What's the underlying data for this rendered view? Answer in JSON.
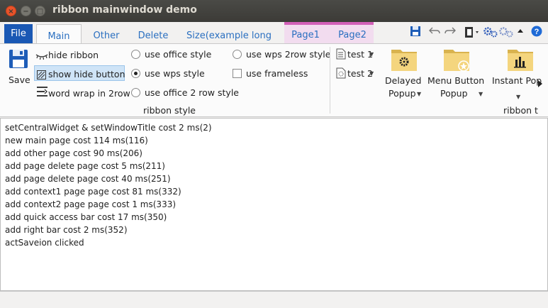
{
  "window": {
    "title": "ribbon mainwindow demo"
  },
  "titlebar": {
    "close_glyph": "×",
    "min_glyph": "−",
    "max_glyph": "□"
  },
  "tabs": {
    "file": "File",
    "items": [
      "Main",
      "Other",
      "Delete",
      "Size(example long page)"
    ],
    "context": [
      "Page1",
      "Page2"
    ],
    "active": "Main"
  },
  "main_page": {
    "save": "Save",
    "hide_ribbon": "hide ribbon",
    "show_hide_button": "show hide button",
    "word_wrap": "word wrap in 2row",
    "use_office_style": "use office style",
    "use_wps_style": "use wps style",
    "use_office_2row": "use office 2 row style",
    "use_wps_2row": "use wps 2row style",
    "use_frameless": "use frameless",
    "group_ribbon_style": "ribbon style",
    "test1": "test 1",
    "test2": "test 2",
    "delayed_popup_l1": "Delayed",
    "delayed_popup_l2": "Popup",
    "menu_button_l1": "Menu Button",
    "menu_button_l2": "Popup",
    "instant_popup_l1": "Instant Pop",
    "group_ribbon_t": "ribbon t"
  },
  "log_lines": [
    "setCentralWidget & setWindowTitle cost 2 ms(2)",
    "new main page cost 114 ms(116)",
    "add other page cost 90 ms(206)",
    "add page delete page cost 5 ms(211)",
    "add page delete page cost 40 ms(251)",
    "add context1 page page cost 81 ms(332)",
    "add context2 page page cost 1 ms(333)",
    "add quick access bar cost 17 ms(350)",
    "add right bar cost 2 ms(352)",
    "actSaveion clicked"
  ],
  "colors": {
    "accent": "#1a58b4",
    "context": "#d25fb7",
    "tab_text": "#2a6fc0",
    "folder": "#f0d27a"
  }
}
